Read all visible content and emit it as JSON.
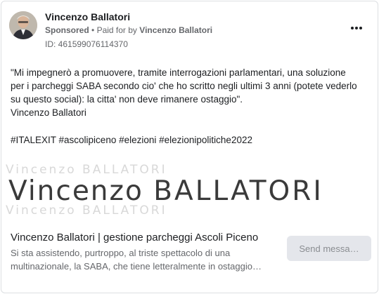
{
  "post": {
    "page_name": "Vincenzo Ballatori",
    "sponsored_label": "Sponsored",
    "separator": "•",
    "paid_for_prefix": "Paid for by",
    "paid_for_name": "Vincenzo Ballatori",
    "ad_id": "ID: 461599076114370",
    "more_icon": "more-horizontal-icon",
    "body_lines": [
      "\"Mi impegnerò a promuovere, tramite interrogazioni parlamentari, una soluzione",
      "per i parcheggi SABA secondo cio' che ho scritto negli ultimi 3 anni (potete vederlo",
      "su questo social): la citta' non deve rimanere ostaggio\".",
      "Vincenzo Ballatori"
    ],
    "hashtags": "#ITALEXIT #ascolipiceno #elezioni #elezionipolitiche2022"
  },
  "banner": {
    "first_name": "Vincenzo",
    "last_name": "BALLATORI",
    "faded_text": "Vincenzo BALLATORI"
  },
  "link": {
    "title": "Vincenzo Ballatori | gestione parcheggi Ascoli Piceno",
    "description_line1": "Si sta assistendo, purtroppo, al triste spettacolo di una",
    "description_line2": "multinazionale, la SABA, che tiene letteralmente in ostaggio…",
    "cta_label": "Send messa…"
  },
  "colors": {
    "text_primary": "#1c1e21",
    "text_secondary": "#65676b",
    "button_bg": "#e4e6eb",
    "border": "#dddfe2"
  }
}
